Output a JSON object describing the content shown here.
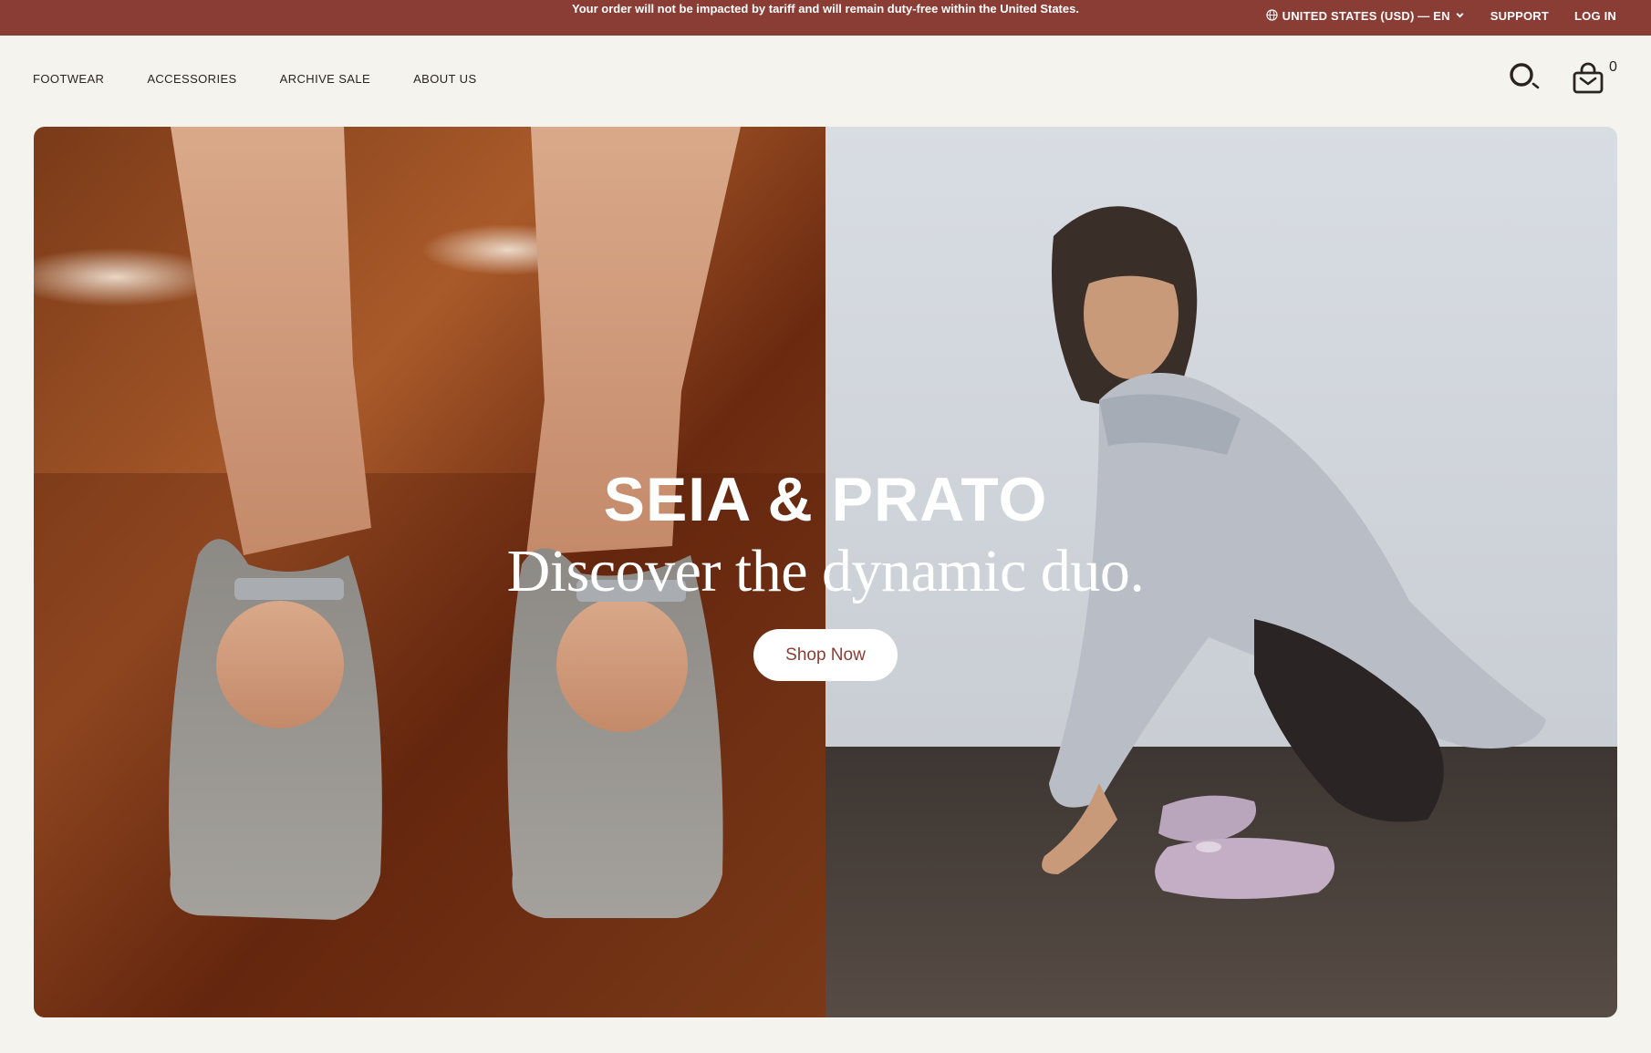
{
  "topbar": {
    "announcement": "Your order will not be impacted by tariff and will remain duty-free within the United States.",
    "region_label": "UNITED STATES (USD) — EN",
    "support_label": "SUPPORT",
    "login_label": "LOG IN"
  },
  "nav": {
    "items": [
      {
        "label": "FOOTWEAR"
      },
      {
        "label": "ACCESSORIES"
      },
      {
        "label": "ARCHIVE SALE"
      },
      {
        "label": "ABOUT US"
      }
    ]
  },
  "header": {
    "search_icon": "search-icon",
    "cart_icon": "shopping-bag-icon",
    "cart_count": "0"
  },
  "hero": {
    "title": "SEIA & PRATO",
    "tagline": "Discover the dynamic duo.",
    "cta_label": "Shop Now"
  },
  "colors": {
    "topbar_bg": "#8a3d34",
    "page_bg": "#f5f3ee",
    "cta_text": "#8a3d34"
  }
}
